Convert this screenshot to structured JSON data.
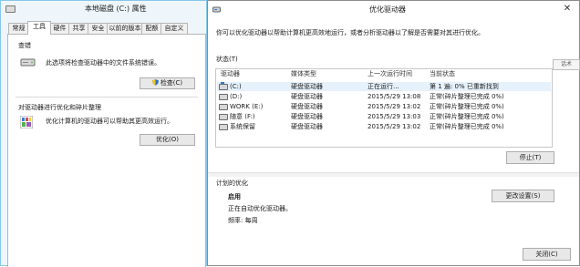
{
  "properties": {
    "title": "本地磁盘 (C:) 属性",
    "tabs": [
      "常规",
      "工具",
      "硬件",
      "共享",
      "安全",
      "以前的版本",
      "配额",
      "自定义"
    ],
    "check": {
      "heading": "查错",
      "description": "此选项将检查驱动器中的文件系统错误。",
      "button": "检查(C)"
    },
    "optimize": {
      "heading": "对驱动器进行优化和碎片整理",
      "description": "优化计算机的驱动器可以帮助其更高效运行。",
      "button": "优化(O)"
    }
  },
  "optimizer": {
    "title": "优化驱动器",
    "intro": "你可以优化驱动器以帮助计算机更高效地运行，或者分析驱动器以了解是否需要对其进行优化。",
    "status_heading": "状态(T)",
    "columns": [
      "驱动器",
      "媒体类型",
      "上一次运行时间",
      "当前状态"
    ],
    "drives": [
      {
        "name": "(C:)",
        "media": "硬盘驱动器",
        "last_run": "正在运行...",
        "status": "第 1 遍: 0% 已重新找到",
        "icon": "system-drive-icon",
        "selected": true
      },
      {
        "name": "(D:)",
        "media": "硬盘驱动器",
        "last_run": "2015/5/29 13:08",
        "status": "正常(碎片整理已完成 0%)",
        "icon": "drive-icon"
      },
      {
        "name": "WORK (E:)",
        "media": "硬盘驱动器",
        "last_run": "2015/5/29 13:02",
        "status": "正常(碎片整理已完成 0%)",
        "icon": "drive-icon"
      },
      {
        "name": "随意 (F:)",
        "media": "硬盘驱动器",
        "last_run": "2015/5/29 13:03",
        "status": "正常(碎片整理已完成 0%)",
        "icon": "drive-icon"
      },
      {
        "name": "系统保留",
        "media": "硬盘驱动器",
        "last_run": "2015/5/29 13:02",
        "status": "正常(碎片整理已完成 0%)",
        "icon": "drive-icon"
      }
    ],
    "tooltip": "话术",
    "stop_button": "停止(T)",
    "scheduled": {
      "heading": "计划的优化",
      "state": "启用",
      "detail": "正在自动优化驱动器。",
      "frequency": "频率: 每周",
      "change_button": "更改设置(S)"
    },
    "close_button": "关闭(C)"
  }
}
